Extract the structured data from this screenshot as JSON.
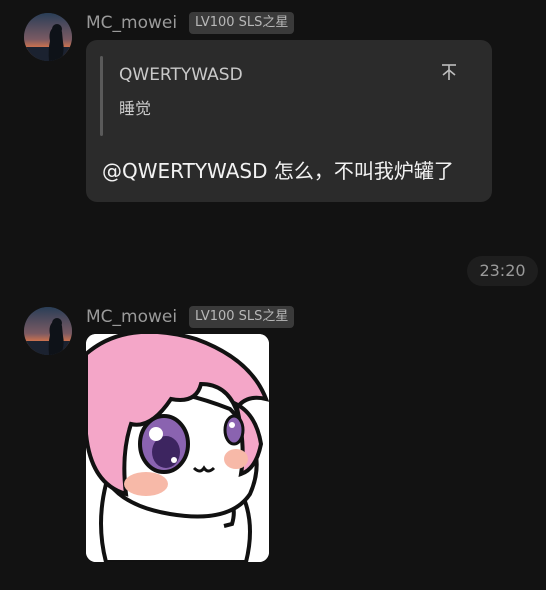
{
  "messages": [
    {
      "sender": "MC_mowei",
      "badge": "LV100 SLS之星",
      "quote": {
        "author": "QWERTYWASD",
        "text": "睡觉",
        "jump_icon": "up-arrow-icon"
      },
      "text": "@QWERTYWASD 怎么，不叫我炉罐了"
    },
    {
      "sender": "MC_mowei",
      "badge": "LV100 SLS之星",
      "sticker": "anime-girl-sticker"
    }
  ],
  "divider_time": "23:20",
  "colors": {
    "background": "#121212",
    "bubble": "#2b2b2b",
    "badge_bg": "#3a3a3a",
    "username": "#9a9a9a"
  }
}
